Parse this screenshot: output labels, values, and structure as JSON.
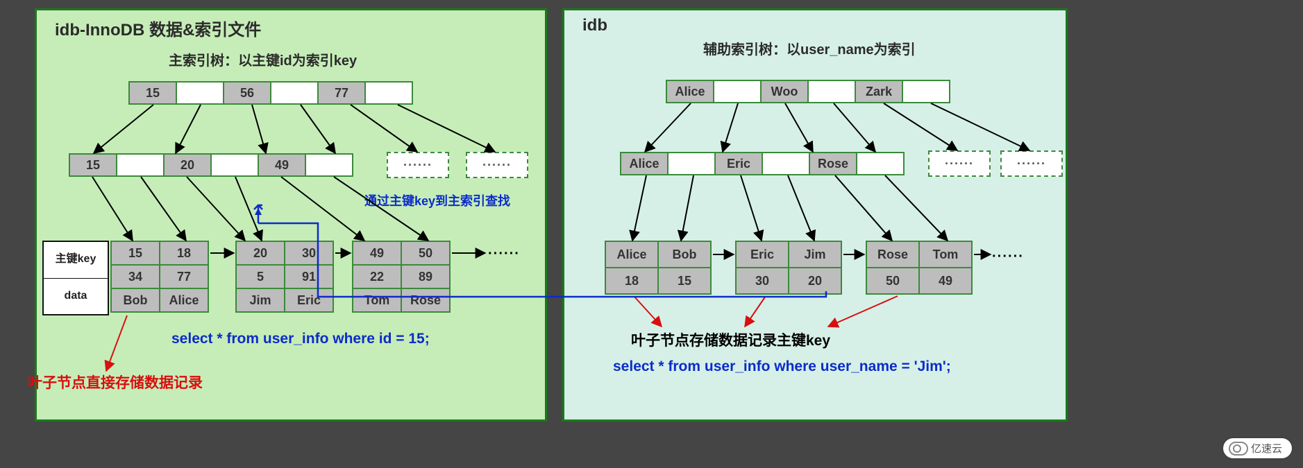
{
  "left": {
    "title": "idb-InnoDB 数据&索引文件",
    "subtitle": "主索引树：以主键id为索引key",
    "root": [
      "15",
      "",
      "56",
      "",
      "77",
      ""
    ],
    "mid": [
      "15",
      "",
      "20",
      "",
      "49",
      ""
    ],
    "ellipsis": "······",
    "kd_labels": {
      "key": "主键key",
      "data": "data"
    },
    "leaves": [
      [
        [
          "15",
          "18"
        ],
        [
          "34",
          "77"
        ],
        [
          "Bob",
          "Alice"
        ]
      ],
      [
        [
          "20",
          "30"
        ],
        [
          "5",
          "91"
        ],
        [
          "Jim",
          "Eric"
        ]
      ],
      [
        [
          "49",
          "50"
        ],
        [
          "22",
          "89"
        ],
        [
          "Tom",
          "Rose"
        ]
      ]
    ],
    "note_blue": "通过主键key到主索引查找",
    "sql": "select  * from user_info  where id = 15;",
    "leaf_caption": "叶子节点直接存储数据记录"
  },
  "right": {
    "title": "idb",
    "subtitle": "辅助索引树：以user_name为索引",
    "root": [
      "Alice",
      "",
      "Woo",
      "",
      "Zark",
      ""
    ],
    "mid": [
      "Alice",
      "",
      "Eric",
      "",
      "Rose",
      ""
    ],
    "ellipsis": "······",
    "leaves": [
      [
        [
          "Alice",
          "Bob"
        ],
        [
          "18",
          "15"
        ]
      ],
      [
        [
          "Eric",
          "Jim"
        ],
        [
          "30",
          "20"
        ]
      ],
      [
        [
          "Rose",
          "Tom"
        ],
        [
          "50",
          "49"
        ]
      ]
    ],
    "leaf_caption": "叶子节点存储数据记录主键key",
    "sql": "select  * from user_info  where user_name = 'Jim';"
  },
  "watermark": "亿速云"
}
